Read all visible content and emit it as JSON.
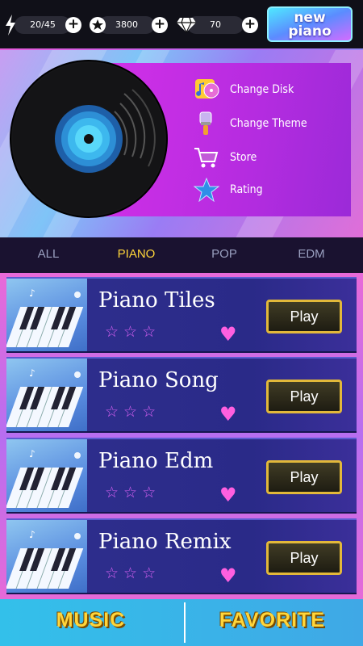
{
  "stats": {
    "energy": "20/45",
    "stars": "3800",
    "diamonds": "70"
  },
  "new_piano": {
    "line1": "new",
    "line2": "piano"
  },
  "menu": [
    {
      "label": "Change Disk",
      "icon": "disk-music-icon"
    },
    {
      "label": "Change Theme",
      "icon": "paint-brush-icon"
    },
    {
      "label": "Store",
      "icon": "shopping-cart-icon"
    },
    {
      "label": "Rating",
      "icon": "star-icon"
    }
  ],
  "tabs": [
    {
      "label": "ALL",
      "active": false
    },
    {
      "label": "PIANO",
      "active": true
    },
    {
      "label": "POP",
      "active": false
    },
    {
      "label": "EDM",
      "active": false
    }
  ],
  "songs": [
    {
      "title": "Piano Tiles",
      "play": "Play",
      "stars": 3
    },
    {
      "title": "Piano Song",
      "play": "Play",
      "stars": 3
    },
    {
      "title": "Piano Edm",
      "play": "Play",
      "stars": 3
    },
    {
      "title": "Piano Remix",
      "play": "Play",
      "stars": 3
    }
  ],
  "bottom": {
    "music": "MUSIC",
    "favorite": "FAVORITE"
  },
  "colors": {
    "accent_yellow": "#ffd53a",
    "tab_bar": "#1a1230",
    "menu_box": "#c22fe2",
    "song_bg": "#2a2a88",
    "play_border": "#e2b83a",
    "bottom_bar": "#33c0ea"
  }
}
